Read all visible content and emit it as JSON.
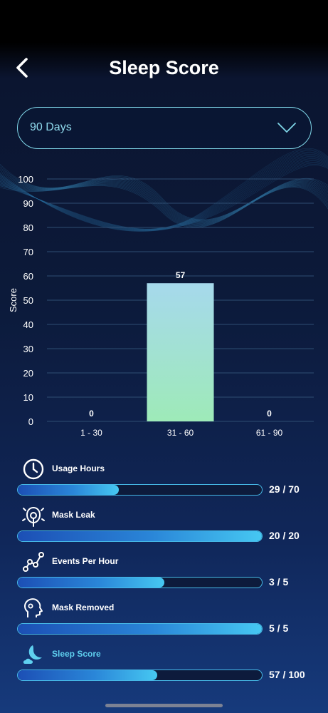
{
  "header": {
    "title": "Sleep Score",
    "back_icon": "chevron-left-icon"
  },
  "range_select": {
    "selected": "90 Days",
    "icon": "chevron-down-icon"
  },
  "chart_data": {
    "type": "bar",
    "ylabel": "Score",
    "xlabel": "",
    "ylim": [
      0,
      100
    ],
    "yticks": [
      0,
      10,
      20,
      30,
      40,
      50,
      60,
      70,
      80,
      90,
      100
    ],
    "categories": [
      "1 - 30",
      "31 - 60",
      "61 - 90"
    ],
    "values": [
      0,
      57,
      0
    ],
    "data_labels": [
      "0",
      "57",
      "0"
    ],
    "grid": true,
    "bar_gradient": [
      "#a6d9ec",
      "#9eeab8"
    ]
  },
  "metrics": [
    {
      "label": "Usage Hours",
      "value": "29 / 70",
      "fraction": 0.414,
      "icon": "clock-icon",
      "active": false
    },
    {
      "label": "Mask Leak",
      "value": "20 / 20",
      "fraction": 1.0,
      "icon": "mask-leak-icon",
      "active": false
    },
    {
      "label": "Events Per Hour",
      "value": "3 / 5",
      "fraction": 0.6,
      "icon": "events-graph-icon",
      "active": false
    },
    {
      "label": "Mask Removed",
      "value": "5 / 5",
      "fraction": 1.0,
      "icon": "head-profile-icon",
      "active": false
    },
    {
      "label": "Sleep Score",
      "value": "57 / 100",
      "fraction": 0.57,
      "icon": "moon-cloud-icon",
      "active": true
    }
  ],
  "colors": {
    "accent": "#5fd0ef",
    "track_border": "#46b8e6",
    "grid": "#2e4d72"
  }
}
